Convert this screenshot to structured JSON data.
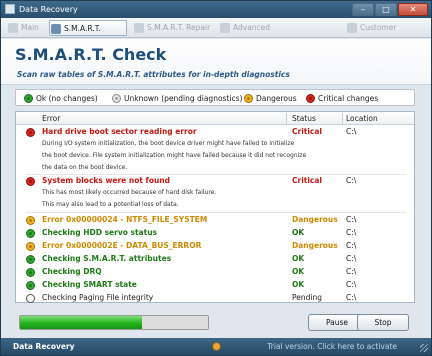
{
  "window": {
    "title": "Data Recovery",
    "buttons": [
      "–",
      "□",
      "✕"
    ]
  },
  "toolbar": {
    "items": [
      {
        "label": "Main",
        "active": false
      },
      {
        "label": "S.M.A.R.T. Check",
        "active": true
      },
      {
        "label": "S.M.A.R.T. Repair",
        "active": false
      },
      {
        "label": "Advanced",
        "active": false
      },
      {
        "label": "Customer Support",
        "active": false
      }
    ]
  },
  "header": {
    "title": "S.M.A.R.T. Check",
    "subtitle": "Scan raw tables of S.M.A.R.T. attributes for in-depth diagnostics"
  },
  "legend": [
    {
      "label": "Ok (no changes)",
      "color": "green"
    },
    {
      "label": "Unknown (pending diagnostics)",
      "color": "gray"
    },
    {
      "label": "Dangerous",
      "color": "orange"
    },
    {
      "label": "Critical changes",
      "color": "red"
    }
  ],
  "table": {
    "columns": [
      "Error",
      "Status",
      "Location"
    ],
    "rows": [
      {
        "error": "Hard drive boot sector reading error",
        "status": "Critical",
        "location": "C:\\",
        "color": "red",
        "description": [
          "During I/O system initialization, the boot device driver might have failed to initialize",
          "the boot device. File system initialization might have failed because it did not recognize",
          "the data on the boot device."
        ]
      },
      {
        "error": "System blocks were not found",
        "status": "Critical",
        "location": "C:\\",
        "color": "red",
        "description": [
          "This has most likely occurred because of hard disk failure.",
          "This may also lead to a potential loss of data."
        ]
      },
      {
        "error": "Error 0x00000024 - NTFS_FILE_SYSTEM",
        "status": "Dangerous",
        "location": "C:\\",
        "color": "orange",
        "description": []
      },
      {
        "error": "Checking HDD servo status",
        "status": "OK",
        "location": "C:\\",
        "color": "green",
        "description": []
      },
      {
        "error": "Error 0x0000002E - DATA_BUS_ERROR",
        "status": "Dangerous",
        "location": "C:\\",
        "color": "orange",
        "description": []
      },
      {
        "error": "Checking S.M.A.R.T. attributes",
        "status": "OK",
        "location": "C:\\",
        "color": "green",
        "description": []
      },
      {
        "error": "Checking DRQ",
        "status": "OK",
        "location": "C:\\",
        "color": "green",
        "description": []
      },
      {
        "error": "Checking SMART state",
        "status": "OK",
        "location": "C:\\",
        "color": "green",
        "description": []
      },
      {
        "error": "Checking Paging File integrity",
        "status": "Pending",
        "location": "C:\\",
        "color": "pending",
        "description": []
      }
    ]
  },
  "progress": {
    "value": 0.65
  },
  "buttons": {
    "pause": "Pause",
    "stop": "Stop"
  },
  "statusbar": {
    "app_name": "Data Recovery",
    "trial_text": "Trial version. Click here to activate"
  },
  "colors": {
    "critical": "#c4170f",
    "ok": "#1f7a16",
    "dangerous": "#cc8a00",
    "accent": "#1f4e7a"
  }
}
